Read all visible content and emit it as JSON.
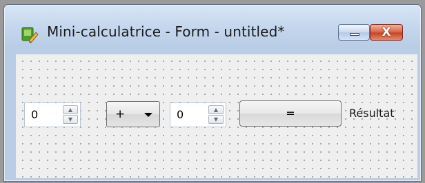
{
  "window": {
    "title": "Mini-calculatrice - Form - untitled*",
    "minimize_icon": "minimize-icon",
    "close_icon": "close-icon",
    "close_glyph": "X"
  },
  "form": {
    "operand1": {
      "value": "0",
      "up_icon": "spin-up-icon",
      "down_icon": "spin-down-icon"
    },
    "operator": {
      "selected": "+",
      "caret_icon": "chevron-down-icon"
    },
    "operand2": {
      "value": "0",
      "up_icon": "spin-up-icon",
      "down_icon": "spin-down-icon"
    },
    "equals_label": "=",
    "result_label": "Résultat"
  },
  "colors": {
    "titlebar": "#c6d8ee",
    "close_button": "#c9452a",
    "form_background": "#efefef"
  }
}
